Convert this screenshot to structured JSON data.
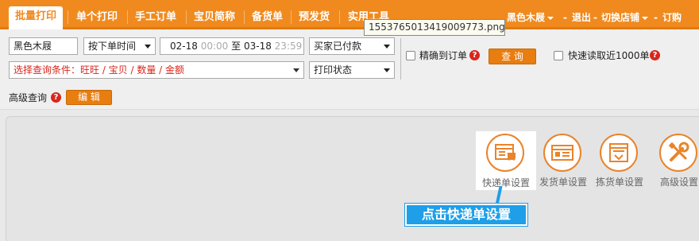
{
  "nav": {
    "tabs": [
      "批量打印",
      "单个打印",
      "手工订单",
      "宝贝简称",
      "备货单",
      "预发货",
      "实用工具"
    ],
    "shop": "黑色木屐",
    "logout": "退出",
    "switch_shop": "切换店铺",
    "subscribe": "订购",
    "dash": "-"
  },
  "tooltip": "1553765013419009773.png",
  "filters": {
    "shop_select": "黑色木屐",
    "time_type": "按下单时间",
    "date_from": "02-18",
    "time_from": "00:00",
    "to_label": "至",
    "date_to": "03-18",
    "time_to": "23:59",
    "status": "买家已付款",
    "exact_label": "精确到订单",
    "query_button": "查 询",
    "fast_label": "快速读取近1000单",
    "condition_placeholder": "选择查询条件：旺旺 / 宝贝 / 数量 / 金额",
    "print_status": "打印状态",
    "advanced_label": "高级查询",
    "edit_button": "编 辑",
    "help_glyph": "?"
  },
  "settings": [
    {
      "label": "快递单设置",
      "icon": "express-form-icon"
    },
    {
      "label": "发货单设置",
      "icon": "delivery-form-icon"
    },
    {
      "label": "拣货单设置",
      "icon": "picking-form-icon"
    },
    {
      "label": "高级设置",
      "icon": "tools-icon"
    }
  ],
  "callout": "点击快递单设置",
  "colors": {
    "accent": "#f08a1e",
    "callout": "#1e9fe8",
    "help": "#d9261c"
  }
}
